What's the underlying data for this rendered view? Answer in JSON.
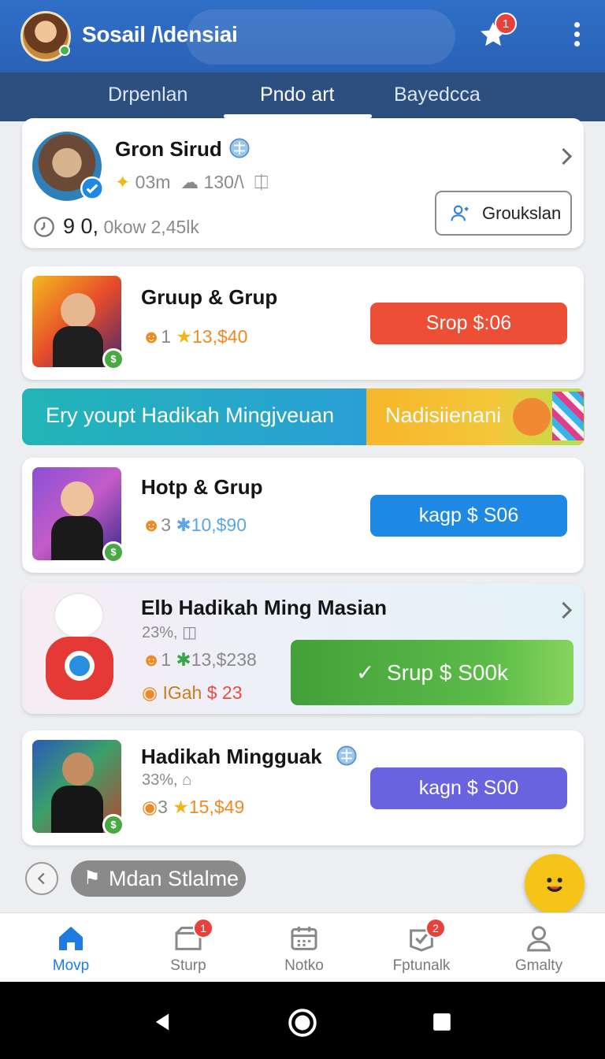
{
  "header": {
    "title": "Sosail /\\densiai",
    "notification_count": "1"
  },
  "tabs": [
    {
      "label": "Drpenlan"
    },
    {
      "label": "Pndo art"
    },
    {
      "label": "Bayedcca"
    }
  ],
  "profile_card": {
    "name": "Gron Sirud",
    "stat1": "03m",
    "stat2": "130/\\",
    "counter_big": "9 0,",
    "counter_rest": "0kow 2,45lk",
    "button_label": "Groukslan"
  },
  "group_cards": [
    {
      "title": "Gruup & Grup",
      "count": "1",
      "value": "13,$40",
      "button_label": "Srop $:06",
      "button_color": "#ec4f35"
    },
    {
      "title": "Hotp & Grup",
      "count": "3",
      "value": "10,$90",
      "button_label": "kagp $ S06",
      "button_color": "#1e88e5"
    }
  ],
  "banner": {
    "left_text": "Ery youpt Hadikah Mingjveuan",
    "right_text": "Nadisiienani"
  },
  "featured_card": {
    "title": "Elb Hadikah Ming Masian",
    "subtitle": "23%,",
    "count": "1",
    "value": "13,$238",
    "reward_label": "IGah",
    "reward_value": "$ 23",
    "button_label": "Srup $ S00k",
    "button_color": "#4aa63a"
  },
  "last_card": {
    "title": "Hadikah Mingguak",
    "subtitle": "33%,",
    "count": "3",
    "value": "15,$49",
    "button_label": "kagn $ S00",
    "button_color": "#6a63e0"
  },
  "chip": {
    "label": "Mdan Stlalme"
  },
  "bottom_nav": [
    {
      "label": "Movp",
      "icon": "home-icon",
      "active": true
    },
    {
      "label": "Sturp",
      "icon": "inbox-icon",
      "badge": "1"
    },
    {
      "label": "Notko",
      "icon": "calendar-icon"
    },
    {
      "label": "Fptunalk",
      "icon": "check-badge-icon",
      "badge": "2"
    },
    {
      "label": "Gmalty",
      "icon": "person-icon"
    }
  ],
  "colors": {
    "header_blue": "#2f6fc7",
    "tab_bar": "#2c4f7f",
    "active_nav": "#1e7be0"
  }
}
